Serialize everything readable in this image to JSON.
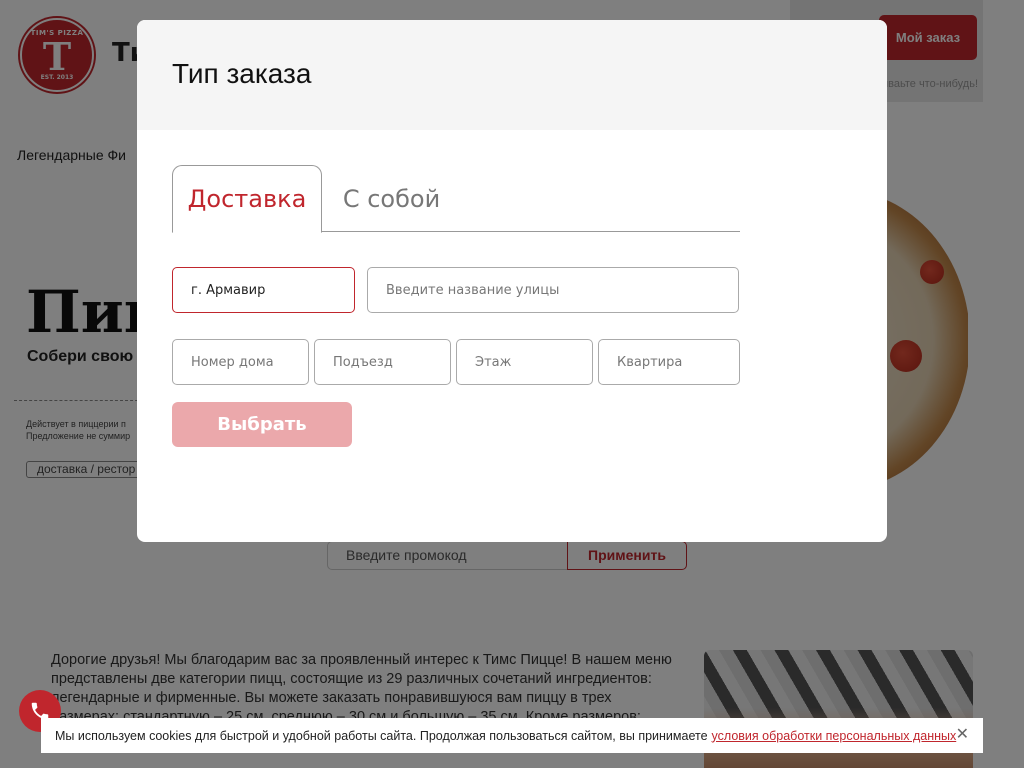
{
  "header": {
    "logo": {
      "top_text": "TIM'S PIZZA",
      "letter": "T",
      "bottom_text": "EST. 2013"
    },
    "brand_text": "Ти",
    "my_order_label": "Мой заказ",
    "search_hint": "зываьте что-нибудь!"
  },
  "nav": {
    "visible_text": "Легендарные  Фи"
  },
  "hero": {
    "title": "Пиц",
    "subtitle": "Собери свою",
    "note_line1": "Действует в пиццерии п",
    "note_line2": "Предложение не суммир",
    "tag": "доставка / рестор"
  },
  "promo": {
    "placeholder": "Введите промокод",
    "apply_label": "Применить"
  },
  "about": {
    "text": "Дорогие друзья! Мы благодарим вас за проявленный интерес к Тимс Пицце! В нашем меню представлены две категории пицц, состоящие из 29 различных сочетаний ингредиентов: легендарные и фирменные. Вы можете заказать понравившуюся вам пиццу в трех размерах: стандартную – 25 см, среднюю – 30 см и большую – 35 см. Кроме размеров: «тонкое» и «пышное». Мы также предлагаем попробовать вашу любимую"
  },
  "modal": {
    "title": "Тип заказа",
    "tabs": [
      {
        "label": "Доставка",
        "active": true
      },
      {
        "label": "С собой",
        "active": false
      }
    ],
    "fields": {
      "city_value": "г. Армавир",
      "street_placeholder": "Введите название улицы",
      "house_placeholder": "Номер дома",
      "entrance_placeholder": "Подъезд",
      "floor_placeholder": "Этаж",
      "apartment_placeholder": "Квартира"
    },
    "select_label": "Выбрать"
  },
  "cookie": {
    "text": "Мы используем cookies для быстрой и удобной работы сайта. Продолжая пользоваться сайтом, вы принимаете",
    "link": "условия обработки персональных данных",
    "close_icon": "✕"
  },
  "colors": {
    "brand": "#c0262d",
    "button_disabled": "#eba8ab",
    "overlay": "rgba(0,0,0,0.5)"
  },
  "icons": {
    "phone": "phone-icon",
    "close": "close-icon"
  }
}
